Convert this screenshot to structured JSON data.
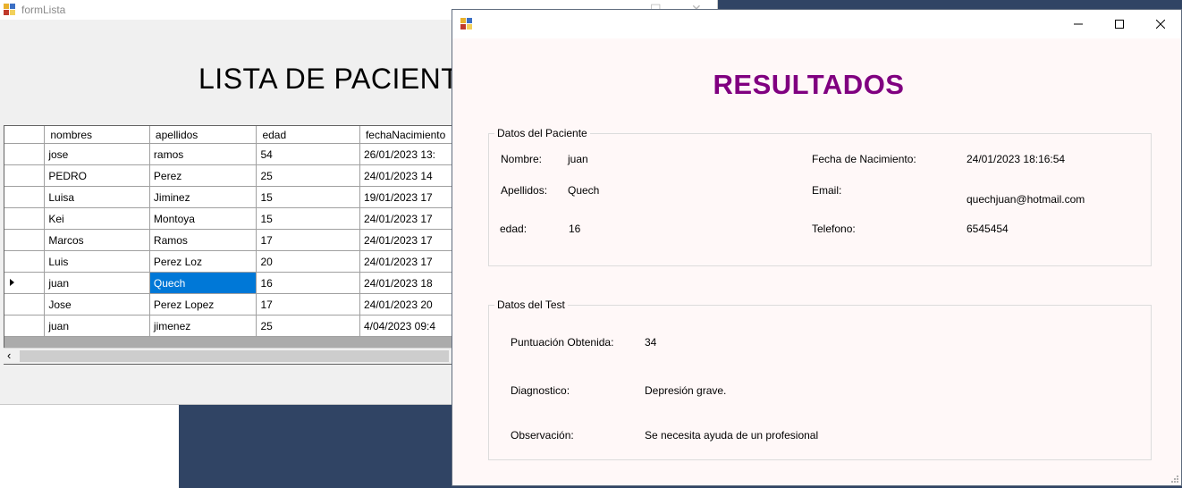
{
  "lista_window": {
    "title": "formLista",
    "heading": "LISTA DE PACIENTES",
    "columns": [
      "nombres",
      "apellidos",
      "edad",
      "fechaNacimiento"
    ],
    "rows": [
      [
        "jose",
        "ramos",
        "54",
        "26/01/2023 13:"
      ],
      [
        "PEDRO",
        "Perez",
        "25",
        "24/01/2023 14"
      ],
      [
        "Luisa",
        "Jiminez",
        "15",
        "19/01/2023 17"
      ],
      [
        "Kei",
        "Montoya",
        "15",
        "24/01/2023 17"
      ],
      [
        "Marcos",
        "Ramos",
        "17",
        "24/01/2023 17"
      ],
      [
        "Luis",
        "Perez Loz",
        "20",
        "24/01/2023 17"
      ],
      [
        "juan",
        "Quech",
        "16",
        "24/01/2023 18"
      ],
      [
        "Jose",
        "Perez Lopez",
        "17",
        "24/01/2023 20"
      ],
      [
        "juan",
        "jimenez",
        "25",
        "4/04/2023 09:4"
      ]
    ],
    "current_row_index": 6,
    "selected_cell": "apellidos",
    "scroll_left_glyph": "‹"
  },
  "resultados_window": {
    "heading": "RESULTADOS",
    "heading_color": "#800080",
    "datos_paciente": {
      "legend": "Datos del Paciente",
      "nombre_label": "Nombre:",
      "nombre_value": "juan",
      "apellidos_label": "Apellidos:",
      "apellidos_value": "Quech",
      "edad_label": "edad:",
      "edad_value": "16",
      "fecha_label": "Fecha de Nacimiento:",
      "fecha_value": "24/01/2023 18:16:54",
      "email_label": "Email:",
      "email_value": "quechjuan@hotmail.com",
      "telefono_label": "Telefono:",
      "telefono_value": "6545454"
    },
    "datos_test": {
      "legend": "Datos del Test",
      "puntuacion_label": "Puntuación Obtenida:",
      "puntuacion_value": "34",
      "diagnostico_label": "Diagnostico:",
      "diagnostico_value": "Depresión grave.",
      "observacion_label": "Observación:",
      "observacion_value": "Se necesita ayuda de un profesional"
    }
  },
  "icons": {
    "app_icon": "winforms-app-icon",
    "minimize": "minimize-icon",
    "maximize": "maximize-icon",
    "close": "close-icon",
    "row_indicator": "row-indicator-icon",
    "resize_grip": "resize-grip-icon"
  },
  "colors": {
    "desktop": "#304464",
    "selection": "#0078d7",
    "form_bg": "#fff8f8"
  }
}
